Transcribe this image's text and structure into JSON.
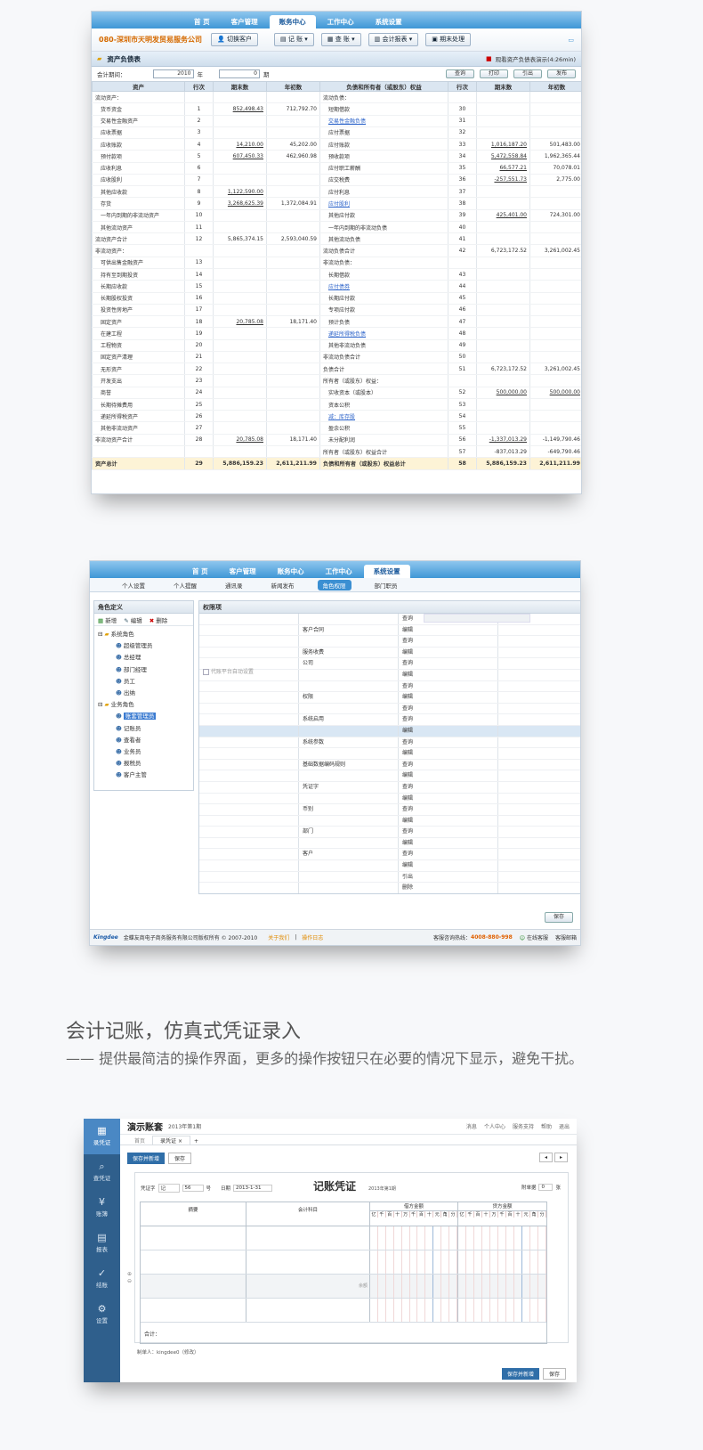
{
  "s1": {
    "nav": [
      "首 页",
      "客户管理",
      "账务中心",
      "工作中心",
      "系统设置"
    ],
    "nav_active": 2,
    "company": "080-深圳市天明发贸易服务公司",
    "switch_btn": "切换客户",
    "tools": [
      "记 账",
      "查 账",
      "会计报表",
      "期末处理"
    ],
    "page_title": "资产负债表",
    "demo_link": "观看资产负债表演示(4:26min)",
    "period_label": "会计期间：",
    "year": "2010",
    "year_unit": "年",
    "period": "0",
    "period_unit": "期",
    "actions": [
      "查询",
      "打印",
      "引出",
      "发布"
    ],
    "headers": [
      "资产",
      "行次",
      "期末数",
      "年初数",
      "负债和所有者（或股东）权益",
      "行次",
      "期末数",
      "年初数"
    ],
    "rows": [
      [
        "流动资产：",
        "",
        "",
        "",
        "流动负债：",
        "",
        "",
        ""
      ],
      [
        "货币资金",
        "1",
        "852,498.43",
        "712,792.70",
        "短期借款",
        "30",
        "",
        ""
      ],
      [
        "交易性金融资产",
        "2",
        "",
        "",
        "交易性金融负债",
        "31",
        "",
        ""
      ],
      [
        "应收票据",
        "3",
        "",
        "",
        "应付票据",
        "32",
        "",
        ""
      ],
      [
        "应收账款",
        "4",
        "14,210.00",
        "45,202.00",
        "应付账款",
        "33",
        "1,016,187.20",
        "501,483.00"
      ],
      [
        "预付款项",
        "5",
        "607,450.33",
        "462,960.98",
        "预收款项",
        "34",
        "5,472,558.84",
        "1,962,365.44"
      ],
      [
        "应收利息",
        "6",
        "",
        "",
        "应付职工薪酬",
        "35",
        "66,577.21",
        "70,078.01"
      ],
      [
        "应收股利",
        "7",
        "",
        "",
        "应交税费",
        "36",
        "-257,551.73",
        "2,775.00"
      ],
      [
        "其他应收款",
        "8",
        "1,122,590.00",
        "",
        "应付利息",
        "37",
        "",
        ""
      ],
      [
        "存货",
        "9",
        "3,268,625.39",
        "1,372,084.91",
        "应付股利",
        "38",
        "",
        ""
      ],
      [
        "一年内到期的非流动资产",
        "10",
        "",
        "",
        "其他应付款",
        "39",
        "425,401.00",
        "724,301.00"
      ],
      [
        "其他流动资产",
        "11",
        "",
        "",
        "一年内到期的非流动负债",
        "40",
        "",
        ""
      ],
      [
        "流动资产合计",
        "12",
        "5,865,374.15",
        "2,593,040.59",
        "其他流动负债",
        "41",
        "",
        ""
      ],
      [
        "非流动资产：",
        "",
        "",
        "",
        "流动负债合计",
        "42",
        "6,723,172.52",
        "3,261,002.45"
      ],
      [
        "可供出售金融资产",
        "13",
        "",
        "",
        "非流动负债：",
        "",
        "",
        ""
      ],
      [
        "持有至到期投资",
        "14",
        "",
        "",
        "长期借款",
        "43",
        "",
        ""
      ],
      [
        "长期应收款",
        "15",
        "",
        "",
        "应付债券",
        "44",
        "",
        ""
      ],
      [
        "长期股权投资",
        "16",
        "",
        "",
        "长期应付款",
        "45",
        "",
        ""
      ],
      [
        "投资性房地产",
        "17",
        "",
        "",
        "专项应付款",
        "46",
        "",
        ""
      ],
      [
        "固定资产",
        "18",
        "20,785.08",
        "18,171.40",
        "预计负债",
        "47",
        "",
        ""
      ],
      [
        "在建工程",
        "19",
        "",
        "",
        "递延所得税负债",
        "48",
        "",
        ""
      ],
      [
        "工程物资",
        "20",
        "",
        "",
        "其他非流动负债",
        "49",
        "",
        ""
      ],
      [
        "固定资产清理",
        "21",
        "",
        "",
        "非流动负债合计",
        "50",
        "",
        ""
      ],
      [
        "无形资产",
        "22",
        "",
        "",
        "负债合计",
        "51",
        "6,723,172.52",
        "3,261,002.45"
      ],
      [
        "开发支出",
        "23",
        "",
        "",
        "所有者（或股东）权益：",
        "",
        "",
        ""
      ],
      [
        "商誉",
        "24",
        "",
        "",
        "实收资本（或股本）",
        "52",
        "500,000.00",
        "500,000.00"
      ],
      [
        "长期待摊费用",
        "25",
        "",
        "",
        "资本公积",
        "53",
        "",
        ""
      ],
      [
        "递延所得税资产",
        "26",
        "",
        "",
        "减：库存股",
        "54",
        "",
        ""
      ],
      [
        "其他非流动资产",
        "27",
        "",
        "",
        "盈余公积",
        "55",
        "",
        ""
      ],
      [
        "非流动资产合计",
        "28",
        "20,785.08",
        "18,171.40",
        "未分配利润",
        "56",
        "-1,337,013.29",
        "-1,149,790.46"
      ],
      [
        "",
        "",
        "",
        "",
        "所有者（或股东）权益合计",
        "57",
        "-837,013.29",
        "-649,790.46"
      ]
    ],
    "total": [
      "资产总计",
      "29",
      "5,886,159.23",
      "2,611,211.99",
      "负债和所有者（或股东）权益总计",
      "58",
      "5,886,159.23",
      "2,611,211.99"
    ]
  },
  "s2": {
    "nav": [
      "首 页",
      "客户管理",
      "账务中心",
      "工作中心",
      "系统设置"
    ],
    "nav_active": 4,
    "subnav": [
      "个人设置",
      "个人提醒",
      "通讯录",
      "新闻发布",
      "角色权限",
      "部门职员"
    ],
    "subnav_active": 4,
    "left_title": "角色定义",
    "left_tools": [
      "新增",
      "编辑",
      "删除"
    ],
    "tree_group1": "系统角色",
    "tree_items1": [
      "超级管理员",
      "总经理",
      "部门经理",
      "员工",
      "出纳"
    ],
    "tree_group2": "业务角色",
    "tree_items2": [
      "账套管理员",
      "记账员",
      "查看者",
      "业务员",
      "报税员",
      "客户主管"
    ],
    "right_title": "权限项",
    "agent_setting": "代账平台自动设置",
    "perm_rows": [
      [
        "",
        "",
        "查询"
      ],
      [
        "",
        "客户合同",
        "编辑"
      ],
      [
        "",
        "",
        "查询"
      ],
      [
        "",
        "服务收费",
        "编辑"
      ],
      [
        "",
        "公司",
        "查询"
      ],
      [
        "",
        "",
        "编辑"
      ],
      [
        "",
        "",
        "查询"
      ],
      [
        "",
        "权限",
        "编辑"
      ],
      [
        "",
        "",
        "查询"
      ],
      [
        "",
        "系统启用",
        "查询"
      ],
      [
        "",
        "",
        "编辑"
      ],
      [
        "",
        "系统参数",
        "查询"
      ],
      [
        "",
        "",
        "编辑"
      ],
      [
        "",
        "基础数据编码规则",
        "查询"
      ],
      [
        "",
        "",
        "编辑"
      ],
      [
        "",
        "凭证字",
        "查询"
      ],
      [
        "",
        "",
        "编辑"
      ],
      [
        "",
        "币别",
        "查询"
      ],
      [
        "",
        "",
        "编辑"
      ],
      [
        "",
        "部门",
        "查询"
      ],
      [
        "",
        "",
        "编辑"
      ],
      [
        "",
        "客户",
        "查询"
      ],
      [
        "",
        "",
        "编辑"
      ],
      [
        "",
        "",
        "引出"
      ],
      [
        "",
        "",
        "删除"
      ]
    ],
    "save": "保存",
    "brand": "Kingdee",
    "copyright": "金蝶友商电子商务服务有限公司版权所有 © 2007-2010",
    "about": "关于我们",
    "log": "操作日志",
    "hotline_label": "客服咨询热线：",
    "hotline": "4008-880-998",
    "online": "在线客服",
    "mail": "客服邮箱"
  },
  "heading": {
    "title": "会计记账，仿真式凭证录入",
    "subtitle": "—— 提供最简洁的操作界面，更多的操作按钮只在必要的情况下显示，避免干扰。"
  },
  "s3": {
    "app_title": "演示账套",
    "app_period": "2013年第1期",
    "top_links": [
      "消息",
      "个人中心",
      "服务支持",
      "帮助",
      "退出"
    ],
    "side": [
      "录凭证",
      "查凭证",
      "账簿",
      "报表",
      "结账",
      "设置"
    ],
    "tabs": [
      "首页",
      "录凭证"
    ],
    "btn_save_new": "保存并新增",
    "btn_save": "保存",
    "voucher_word_label": "凭证字",
    "voucher_word": "记",
    "voucher_no": "56",
    "no_label": "号",
    "date_label": "日期",
    "date": "2013-1-31",
    "voucher_title": "记账凭证",
    "voucher_period": "2013年第1期",
    "attach_label": "附单据",
    "attach_count": "0",
    "attach_unit": "张",
    "col_summary": "摘要",
    "col_account": "会计科目",
    "col_debit": "借方金额",
    "col_credit": "贷方金额",
    "digits": [
      "亿",
      "千",
      "百",
      "十",
      "万",
      "千",
      "百",
      "十",
      "元",
      "角",
      "分"
    ],
    "balance_label": "余额",
    "total_label": "合计：",
    "maker": "制单人：kingdee0（修改）"
  }
}
